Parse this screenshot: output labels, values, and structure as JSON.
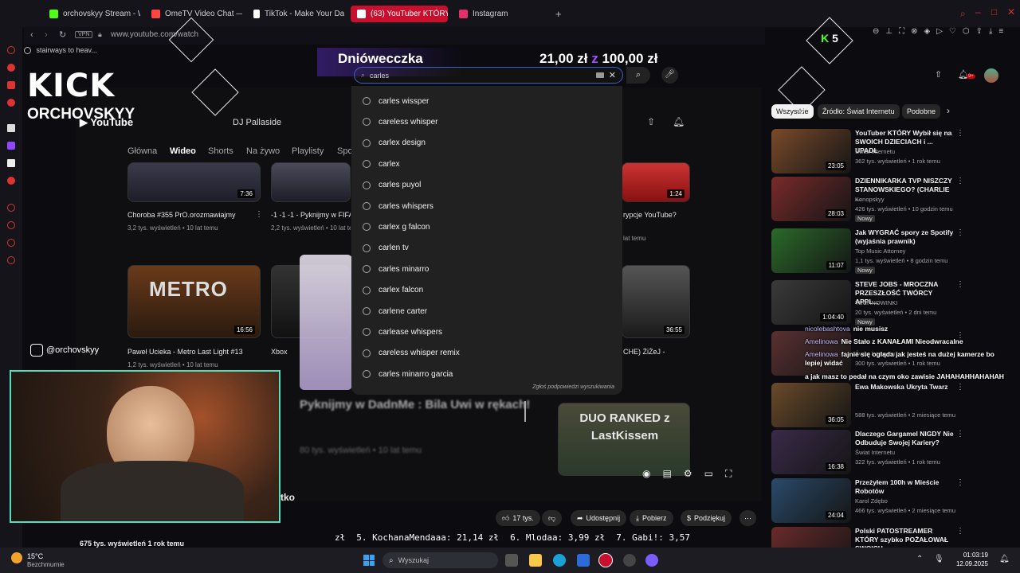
{
  "browser": {
    "tabs": [
      {
        "label": "orchovskyy Stream - Wat",
        "color": "#53fc18"
      },
      {
        "label": "OmeTV Video Chat — Om",
        "color": "#ff4444"
      },
      {
        "label": "TikTok - Make Your Day",
        "color": "#ffffff"
      },
      {
        "label": "(63) YouTuber KTÓRY dla",
        "color": "#ff0000"
      },
      {
        "label": "Instagram",
        "color": "#e1306c"
      }
    ],
    "vpn_label": "VPN",
    "url": "www.youtube.com/watch",
    "bookmark": "stairways to heav...",
    "kick_badge": "5"
  },
  "stream_overlay": {
    "kick_logo": "KICK",
    "streamer_name": "ORCHOVSKYY",
    "instagram_handle": "@orchovskyy",
    "donation_name": "Dniówecczka",
    "donation_progress": "21,00 zł",
    "donation_sep": "z",
    "donation_goal": "100,00 zł",
    "ticker": [
      "zł",
      "5. KochanaMendaaa: 21,14 zł",
      "6. Mlodaa: 3,99 zł",
      "7. Gabi!: 3,57"
    ],
    "chat": [
      {
        "user": "nicolebashtova",
        "text": "nie musisz"
      },
      {
        "user": "Amelinowa",
        "text": "Nie Stało z KANAŁAMI Nieodwracalne"
      },
      {
        "user": "Amelinowa",
        "text": "fajnie się ogląda jak jesteś na dużej kamerze bo lepiej widać"
      },
      {
        "user": "",
        "text": "a jak masz to pedał na czym oko zawisie JAHAHAHHAHAHAH"
      }
    ]
  },
  "youtube": {
    "search_value": "carles",
    "channel_name": "DJ Pallaside",
    "channel_tabs": [
      "Główna",
      "Wideo",
      "Shorts",
      "Na żywo",
      "Playlisty",
      "Spo"
    ],
    "suggestions": [
      "carles wissper",
      "careless whisper",
      "carlex design",
      "carlex",
      "carles puyol",
      "carles whispers",
      "carlex g falcon",
      "carlen tv",
      "carles minarro",
      "carlex falcon",
      "carlene carter",
      "carlease whispers",
      "careless whisper remix",
      "carles minarro garcia"
    ],
    "suggestion_report": "Zgłoś podpowiedzi wyszukiwania",
    "grid": [
      {
        "title": "Choroba #355 PrO.orozmawiajmy",
        "meta": "3,2 tys. wyświetleń • 10 lat temu",
        "dur": "7:36"
      },
      {
        "title": "-1 -1 -1 - Pyknijmy w FIFA",
        "meta": "2,2 tys. wyświetleń • 10 lat temu",
        "dur": ""
      },
      {
        "title": "rypcje YouTube?",
        "meta": "lat temu",
        "dur": "1:24"
      },
      {
        "title": "Paweł Ucieka - Metro Last Light #13",
        "meta": "1,2 tys. wyświetleń • 10 lat temu",
        "dur": "16:56"
      },
      {
        "title": "Xbox",
        "meta": "",
        "dur": ""
      },
      {
        "title": "CHE) ŻiŻeJ -",
        "meta": "lat temu",
        "dur": "36:55"
      }
    ],
    "blurred_title": "Pyknijmy w DadnMe : Bila Uwi w rękach!",
    "blurred_meta": "80 tys. wyświetleń • 10 lat temu",
    "duo_thumb_text": "DUO RANKED z LastKissem",
    "video_title_tail": "tko",
    "views_line": "675 tys. wyświetleń  1 rok temu",
    "actions": {
      "likes": "17 tys.",
      "share": "Udostępnij",
      "download": "Pobierz",
      "thanks": "Podziękuj"
    },
    "chips": [
      "Wszystkie",
      "Źródło: Świat Internetu",
      "Podobne"
    ],
    "notif_count": "9+",
    "recommendations": [
      {
        "title": "YouTuber KTÓRY Wybił się na SWOICH DZIECIACH i ... UPADŁ",
        "channel": "Świat Internetu",
        "meta": "362 tys. wyświetleń • 1 rok temu",
        "dur": "23:05",
        "badge": "",
        "color": "#7a4a2a"
      },
      {
        "title": "DZIENNIKARKA TVP NISZCZY STANOWSKIEGO? (CHARLIE ...",
        "channel": "Konopskyy",
        "meta": "426 tys. wyświetleń • 10 godzin temu",
        "dur": "28:03",
        "badge": "Nowy",
        "color": "#7a2a2a"
      },
      {
        "title": "Jak WYGRAĆ spory ze Spotify (wyjaśnia prawnik)",
        "channel": "Top Music Attorney",
        "meta": "1,1 tys. wyświetleń • 8 godzin temu",
        "dur": "11:07",
        "badge": "Nowy",
        "color": "#2a6a2a"
      },
      {
        "title": "STEVE JOBS - MROCZNA PRZESZŁOŚĆ TWÓRCY APPL...",
        "channel": "TECHNOWINKI",
        "meta": "20 tys. wyświetleń • 2 dni temu",
        "dur": "1:04:40",
        "badge": "Nowy",
        "color": "#3a3a3a"
      },
      {
        "title": "",
        "channel": "Świat Internetu",
        "meta": "300 tys. wyświetleń • 1 rok temu",
        "dur": "",
        "badge": "",
        "color": "#5a3030"
      },
      {
        "title": "Ewa Makowska Ukryta Twarz",
        "channel": "",
        "meta": "588 tys. wyświetleń • 2 miesiące temu",
        "dur": "36:05",
        "badge": "",
        "color": "#6a4a2a"
      },
      {
        "title": "Dlaczego Gargamel NIGDY Nie Odbuduje Swojej Kariery?",
        "channel": "Świat Internetu",
        "meta": "322 tys. wyświetleń • 1 rok temu",
        "dur": "16:38",
        "badge": "",
        "color": "#3a2a4a"
      },
      {
        "title": "Przeżyłem 100h w Mieście Robotów",
        "channel": "Karol Zdębo",
        "meta": "466 tys. wyświetleń • 2 miesiące temu",
        "dur": "24:04",
        "badge": "",
        "color": "#2a4a6a"
      },
      {
        "title": "Polski PATOSTREAMER KTÓRY szybko POŻAŁOWAŁ SWOICH ...",
        "channel": "",
        "meta": "",
        "dur": "",
        "badge": "",
        "color": "#6a2a2a"
      }
    ]
  },
  "taskbar": {
    "weather_temp": "15°C",
    "weather_desc": "Bezchmurnie",
    "search_placeholder": "Wyszukaj",
    "time": "01:03:19",
    "date": "12.09.2025"
  }
}
